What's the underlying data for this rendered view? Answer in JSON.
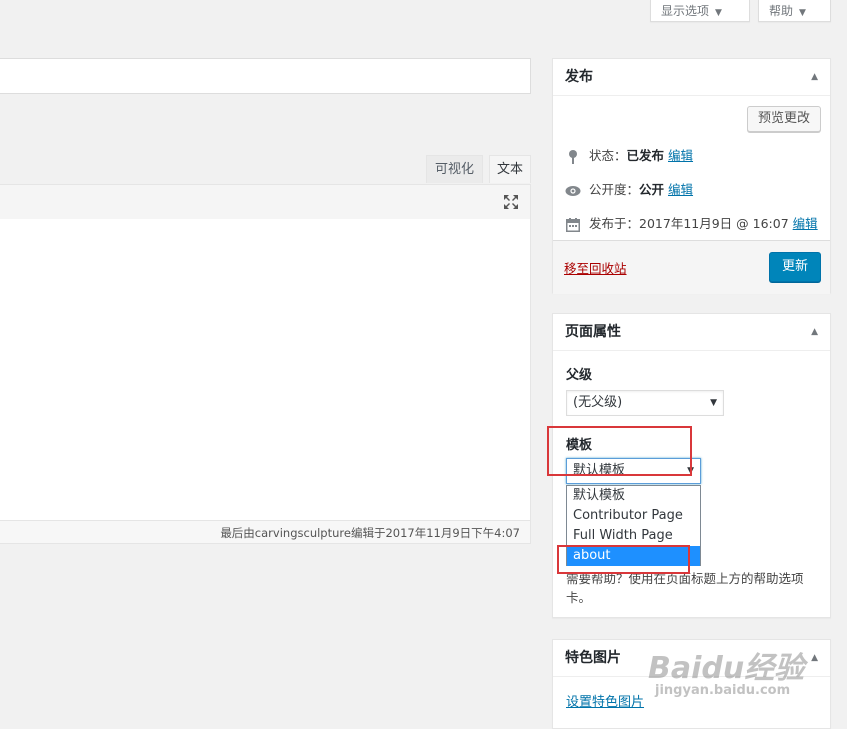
{
  "top_buttons": {
    "screen_options": "显示选项",
    "help": "帮助"
  },
  "editor": {
    "tabs": [
      "可视化",
      "文本"
    ],
    "status": "最后由carvingsculpture编辑于2017年11月9日下午4:07"
  },
  "publish": {
    "title": "发布",
    "preview_button": "预览更改",
    "status_label": "状态：",
    "status_value": "已发布",
    "visibility_label": "公开度：",
    "visibility_value": "公开",
    "published_label": "发布于：",
    "published_value": "2017年11月9日 @ 16:07",
    "edit_link": "编辑",
    "trash_link": "移至回收站",
    "update_button": "更新"
  },
  "page_attributes": {
    "title": "页面属性",
    "parent_label": "父级",
    "parent_value": "(无父级)",
    "template_label": "模板",
    "template_value": "默认模板",
    "template_options": [
      "默认模板",
      "Contributor Page",
      "Full Width Page",
      "about"
    ],
    "help_text": "需要帮助？使用在页面标题上方的帮助选项卡。"
  },
  "featured_image": {
    "title": "特色图片",
    "set_link": "设置特色图片"
  },
  "watermark": {
    "brand": "Baidu经验",
    "url": "jingyan.baidu.com"
  },
  "colors": {
    "accent": "#0085ba",
    "link": "#0073aa",
    "danger": "#a00",
    "highlight_box": "#d9373a"
  }
}
